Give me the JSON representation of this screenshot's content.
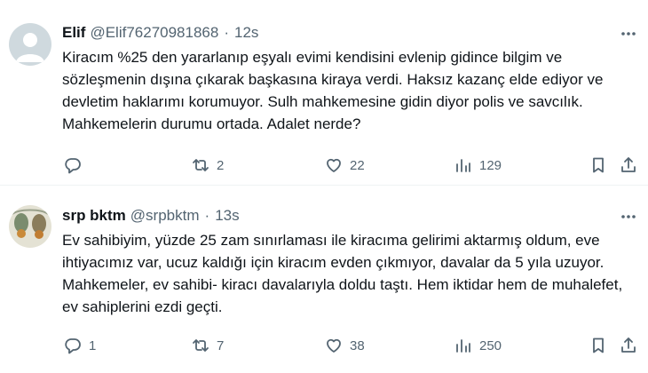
{
  "tweets": [
    {
      "name": "Elif",
      "handle": "@Elif76270981868",
      "dot": "·",
      "time": "12s",
      "text": "Kiracım %25 den yararlanıp eşyalı evimi kendisini evlenip gidince bilgim ve sözleşmenin dışına çıkarak başkasına kiraya verdi. Haksız kazanç elde ediyor ve devletim haklarımı korumuyor. Sulh mahkemesine gidin diyor polis ve savcılık. Mahkemelerin durumu ortada. Adalet nerde?",
      "replies": "",
      "retweets": "2",
      "likes": "22",
      "views": "129",
      "avatar": "default-avatar"
    },
    {
      "name": "srp bktm",
      "handle": "@srpbktm",
      "dot": "·",
      "time": "13s",
      "text": "Ev sahibiyim, yüzde 25 zam sınırlaması ile kiracıma gelirimi aktarmış oldum, eve ihtiyacımız var, ucuz kaldığı için kiracım evden çıkmıyor, davalar da 5 yıla uzuyor. Mahkemeler, ev sahibi- kiracı davalarıyla doldu taştı. Hem iktidar hem de muhalefet, ev sahiplerini ezdi geçti.",
      "replies": "1",
      "retweets": "7",
      "likes": "38",
      "views": "250",
      "avatar": "photo-avatar"
    }
  ],
  "icons": {
    "more": "more-icon",
    "reply": "reply-icon",
    "retweet": "retweet-icon",
    "like": "like-icon",
    "views": "views-icon",
    "bookmark": "bookmark-icon",
    "share": "share-icon"
  },
  "colors": {
    "text": "#0f1419",
    "secondary": "#536471",
    "divider": "#eff3f4",
    "default_avatar_bg": "#cfd9de"
  }
}
